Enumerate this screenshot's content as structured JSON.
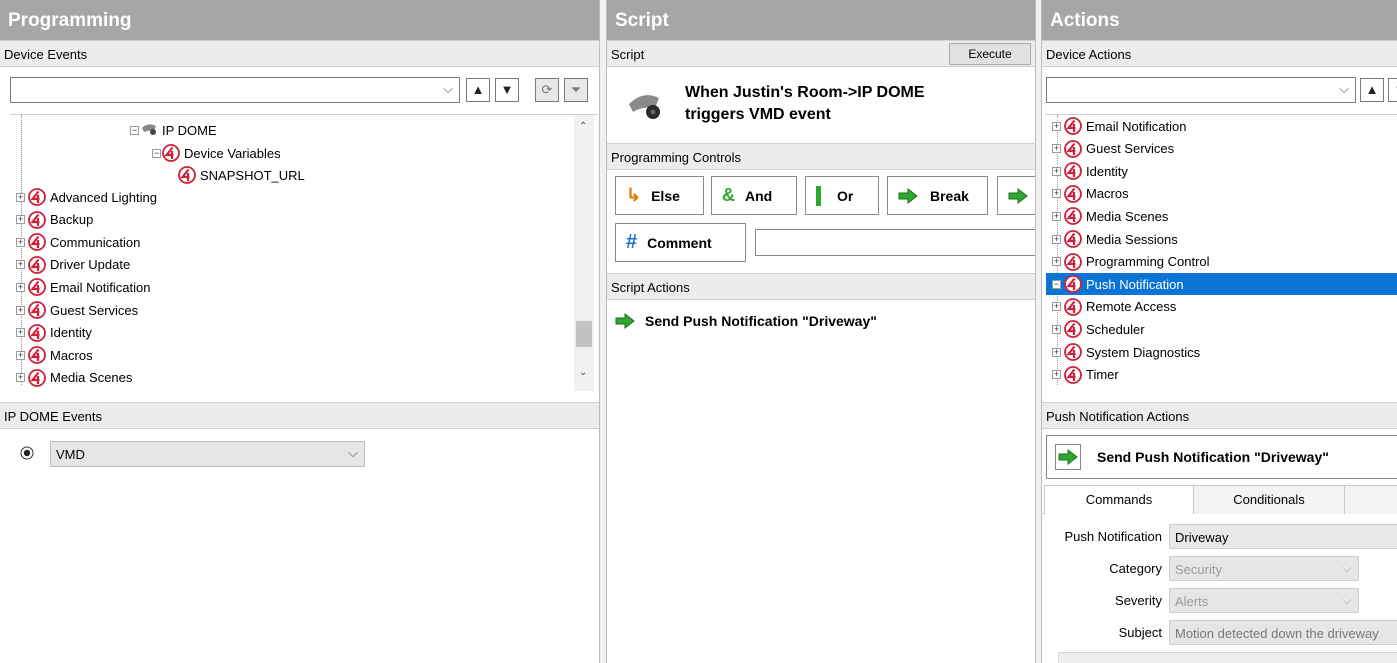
{
  "left": {
    "title": "Programming",
    "device_events_header": "Device Events",
    "device_tree": {
      "root": "IP DOME",
      "child": "Device Variables",
      "leaf": "SNAPSHOT_URL"
    },
    "items": [
      "Advanced Lighting",
      "Backup",
      "Communication",
      "Driver Update",
      "Email Notification",
      "Guest Services",
      "Identity",
      "Macros",
      "Media Scenes"
    ],
    "events_header": "IP DOME Events",
    "event_selected": "VMD"
  },
  "mid": {
    "title": "Script",
    "script_header": "Script",
    "execute_label": "Execute",
    "trigger_line1": "When Justin's Room->IP DOME",
    "trigger_line2": "triggers VMD event",
    "controls_header": "Programming Controls",
    "buttons": {
      "else": "Else",
      "and": "And",
      "or": "Or",
      "break": "Break",
      "comment": "Comment"
    },
    "comment_value": "",
    "actions_header": "Script Actions",
    "action": "Send Push Notification \"Driveway\""
  },
  "right": {
    "title": "Actions",
    "device_actions_header": "Device Actions",
    "items": [
      "Email Notification",
      "Guest Services",
      "Identity",
      "Macros",
      "Media Scenes",
      "Media Sessions",
      "Programming Control",
      "Push Notification",
      "Remote Access",
      "Scheduler",
      "System Diagnostics",
      "Timer"
    ],
    "selected_item": "Push Notification",
    "push_actions_header": "Push Notification Actions",
    "push_action": "Send Push Notification \"Driveway\"",
    "tabs": [
      "Commands",
      "Conditionals"
    ],
    "fields": {
      "push_label": "Push Notification",
      "push_value": "Driveway",
      "category_label": "Category",
      "category_value": "Security",
      "severity_label": "Severity",
      "severity_value": "Alerts",
      "subject_label": "Subject",
      "subject_value": "Motion detected down the driveway"
    }
  },
  "colors": {
    "panel_title_bg": "#a6a6a6",
    "selection": "#0a74d5",
    "control4_red": "#d0203a",
    "green_arrow": "#2fa82f",
    "comment_hash": "#1b73c9"
  },
  "icons": [
    "control4-icon",
    "camera-icon",
    "green-arrow-icon",
    "refresh-icon",
    "filter-icon",
    "else-icon",
    "and-icon",
    "or-icon",
    "hash-icon"
  ]
}
